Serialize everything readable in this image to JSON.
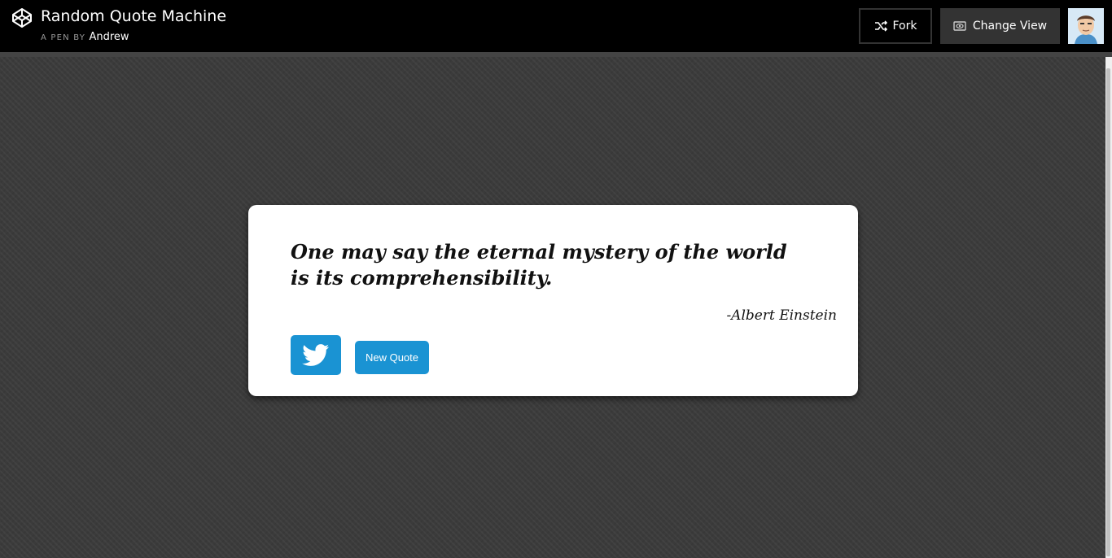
{
  "header": {
    "title": "Random Quote Machine",
    "byline_prefix": "A PEN BY",
    "author": "Andrew",
    "fork_label": "Fork",
    "change_view_label": "Change View"
  },
  "quote": {
    "text": "One may say the eternal mystery of the world is its comprehensibility.",
    "author": "-Albert Einstein"
  },
  "actions": {
    "new_quote_label": "New Quote"
  },
  "icons": {
    "logo": "codepen-logo-icon",
    "fork": "fork-icon",
    "change_view": "eye-icon",
    "tweet": "twitter-bird-icon"
  },
  "colors": {
    "header_bg": "#000000",
    "page_bg": "#3d3d3d",
    "card_bg": "#ffffff",
    "accent": "#1a93d3"
  }
}
